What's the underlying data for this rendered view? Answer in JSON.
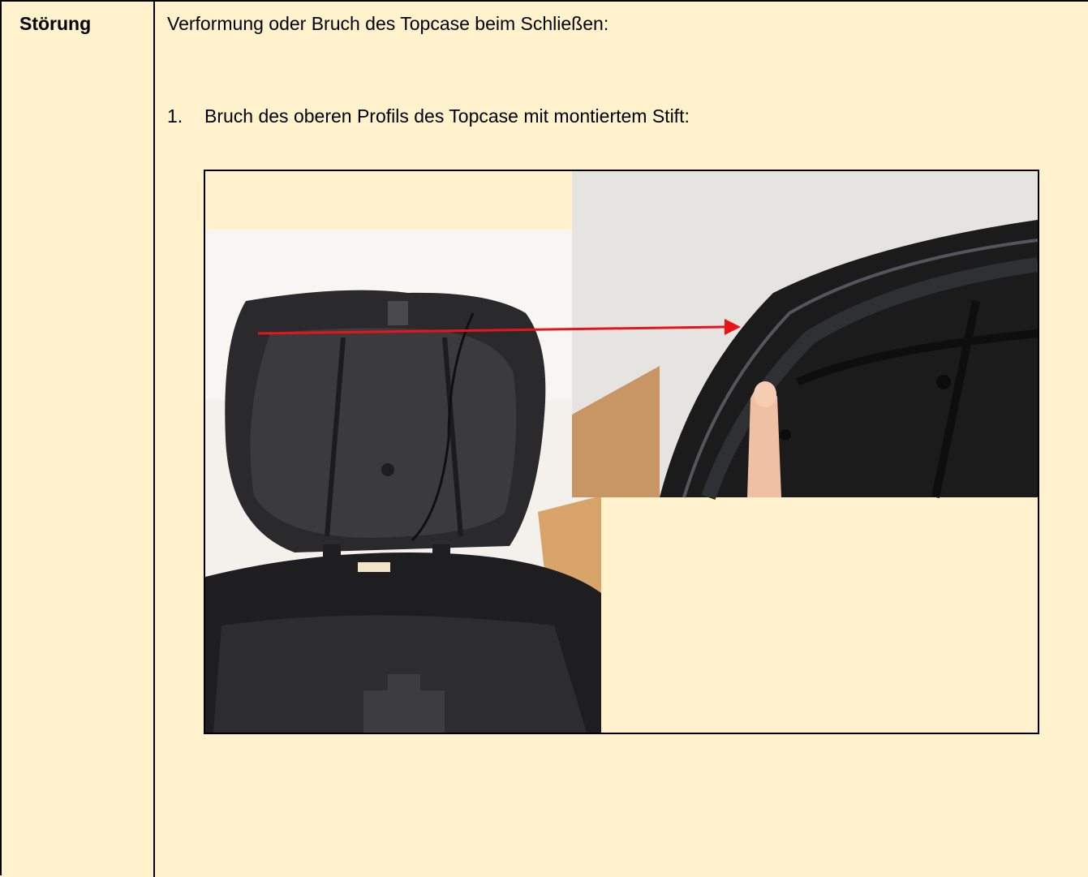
{
  "table": {
    "label": "Störung",
    "heading": "Verformung oder Bruch des Topcase beim Schließen:",
    "items": [
      {
        "number": "1.",
        "text": "Bruch des oberen Profils des Topcase mit montiertem Stift:"
      }
    ]
  },
  "figure": {
    "panels": [
      "photo-open-topcase",
      "photo-detail-broken-profile"
    ],
    "arrow_color": "#e8141a"
  }
}
